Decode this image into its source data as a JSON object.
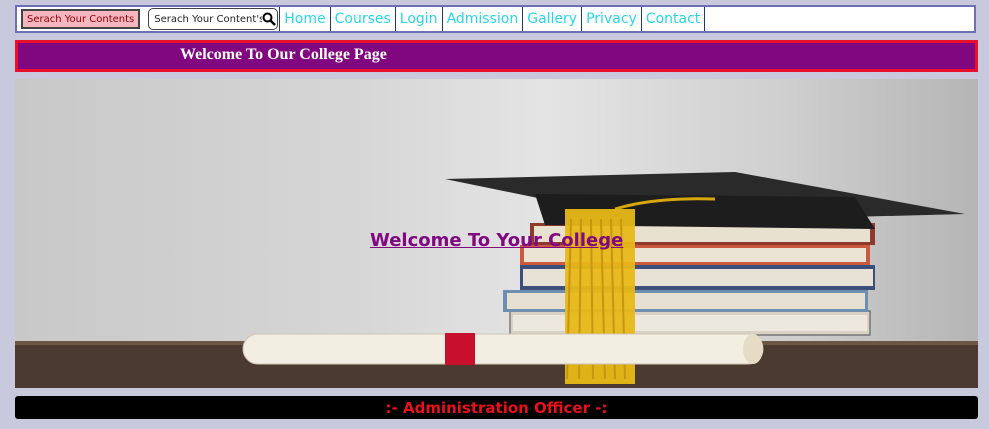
{
  "topbar": {
    "search_button_label": "Serach Your Contents",
    "search_placeholder": "Serach Your Content's.",
    "nav": [
      "Home",
      "Courses",
      "Login",
      "Admission",
      "Gallery",
      "Privacy",
      "Contact"
    ]
  },
  "welcome_bar": {
    "text": "Welcome To Our College Page"
  },
  "hero": {
    "text": "Welcome To Your College"
  },
  "admin_bar": {
    "text": ":- Administration Officer -:"
  },
  "icons": {
    "search": "search-icon"
  },
  "colors": {
    "nav_text": "#29d6e6",
    "welcome_bar_bg": "#80077f",
    "welcome_bar_border": "#e8102a",
    "hero_text": "#800880",
    "admin_text": "#e8101a"
  }
}
